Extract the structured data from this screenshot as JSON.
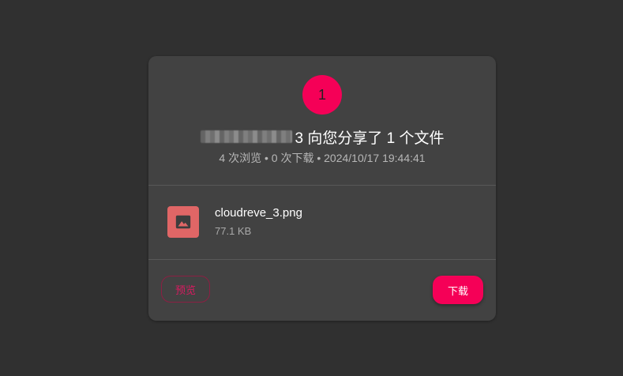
{
  "share": {
    "avatar_initial": "1",
    "title_suffix": "3 向您分享了 1 个文件",
    "meta": "4 次浏览 • 0 次下载 • 2024/10/17 19:44:41"
  },
  "file": {
    "name": "cloudreve_3.png",
    "size": "77.1 KB",
    "icon": "image-icon",
    "icon_color": "#e06666"
  },
  "actions": {
    "preview_label": "预览",
    "download_label": "下载"
  },
  "colors": {
    "accent": "#f50057",
    "background": "#303030",
    "card": "#424242"
  }
}
